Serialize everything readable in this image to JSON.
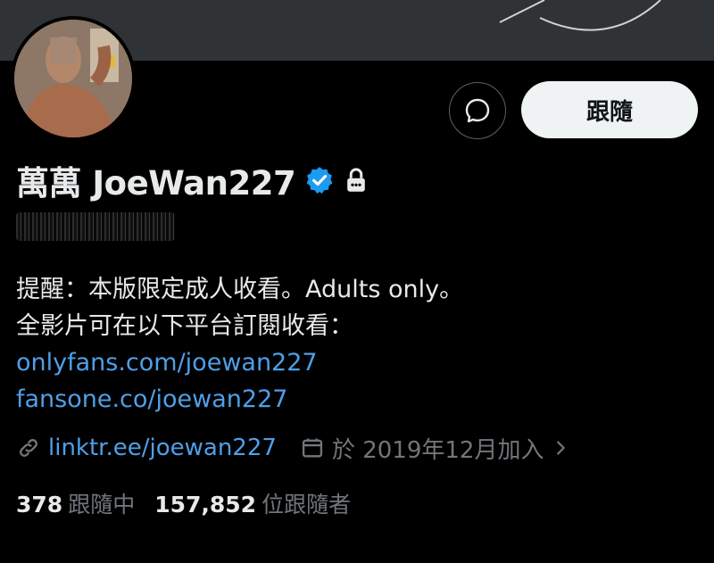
{
  "profile": {
    "display_name": "萬萬 JoeWan227",
    "follow_label": "跟隨",
    "bio_line1": "提醒：本版限定成人收看。Adults only。",
    "bio_line2": "全影片可在以下平台訂閱收看：",
    "bio_link1": "onlyfans.com/joewan227",
    "bio_link2": "fansone.co/joewan227",
    "website": "linktr.ee/joewan227",
    "joined": "於 2019年12月加入",
    "following_count": "378",
    "following_label": "跟隨中",
    "followers_count": "157,852",
    "followers_label": "位跟隨者"
  },
  "icons": {
    "message": "chat-bubble-icon",
    "verified": "verified-badge-icon",
    "protected": "lock-icon",
    "link": "link-icon",
    "calendar": "calendar-icon",
    "chevron": "chevron-right-icon"
  },
  "colors": {
    "background": "#000000",
    "banner": "#2f3336",
    "text": "#e7e9ea",
    "muted": "#71767b",
    "link": "#4f9fe8",
    "verified": "#1d9bf0",
    "follow_button": "#eff3f4"
  }
}
